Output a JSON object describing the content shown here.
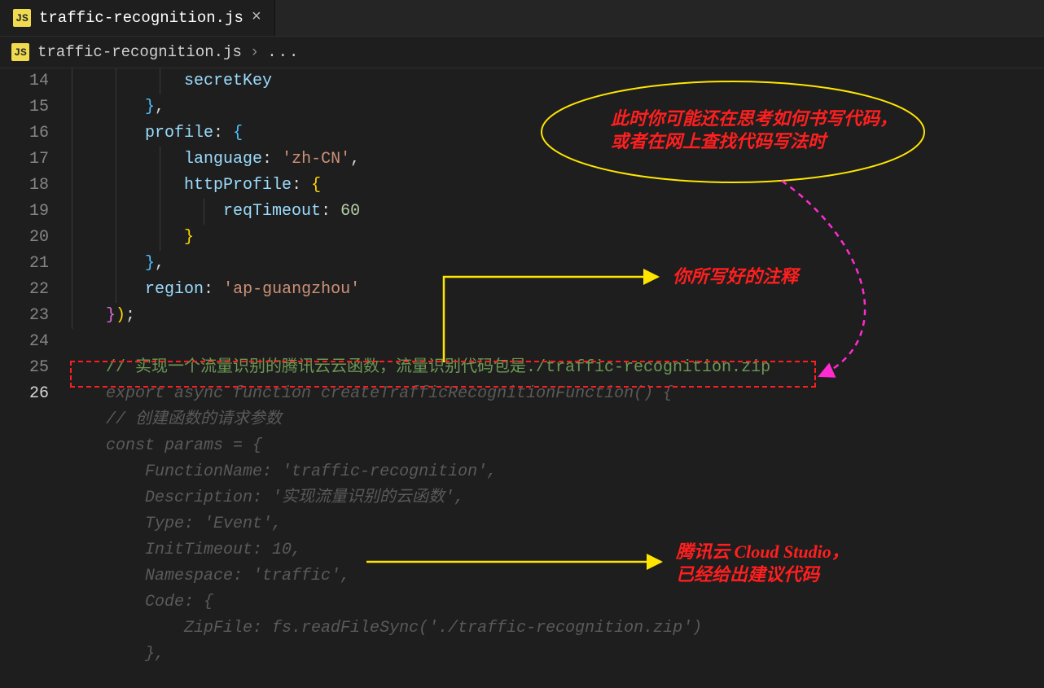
{
  "tab": {
    "filename": "traffic-recognition.js",
    "close": "×"
  },
  "breadcrumb": {
    "icon": "JS",
    "filename": "traffic-recognition.js",
    "sep": "›",
    "dots": "..."
  },
  "lines": {
    "n14": "14",
    "n15": "15",
    "n16": "16",
    "n17": "17",
    "n18": "18",
    "n19": "19",
    "n20": "20",
    "n21": "21",
    "n22": "22",
    "n23": "23",
    "n24": "24",
    "n25": "25",
    "n26": "26"
  },
  "code": {
    "l14_secretKey": "secretKey",
    "l15_brace": "}",
    "l15_comma": ",",
    "l16_profile": "profile",
    "l16_colon": ":",
    "l16_brace": "{",
    "l17_lang": "language",
    "l17_colon": ":",
    "l17_val": "'zh-CN'",
    "l17_comma": ",",
    "l18_http": "httpProfile",
    "l18_colon": ":",
    "l18_brace": "{",
    "l19_req": "reqTimeout",
    "l19_colon": ":",
    "l19_val": "60",
    "l20_brace": "}",
    "l21_brace": "}",
    "l21_comma": ",",
    "l22_region": "region",
    "l22_colon": ":",
    "l22_val": "'ap-guangzhou'",
    "l23_brace1": "}",
    "l23_paren": ")",
    "l23_semi": ";",
    "l25_comment": "// 实现一个流量识别的腾讯云云函数，流量识别代码包是./traffic-recognition.zip",
    "l26_ghost": "export async function createTrafficRecognitionFunction() {"
  },
  "ghost": {
    "g1": "    // 创建函数的请求参数",
    "g2": "    const params = {",
    "g3": "        FunctionName: 'traffic-recognition',",
    "g4": "        Description: '实现流量识别的云函数',",
    "g5": "        Type: 'Event',",
    "g6": "        InitTimeout: 10,",
    "g7": "        Namespace: 'traffic',",
    "g8": "        Code: {",
    "g9": "            ZipFile: fs.readFileSync('./traffic-recognition.zip')",
    "g10": "        },"
  },
  "annotations": {
    "ellipse1": "此时你可能还在思考如何书写代码，",
    "ellipse2": "或者在网上查找代码写法时",
    "arrow1": "你所写好的注释",
    "arrow2a": "腾讯云 Cloud Studio，",
    "arrow2b": "已经给出建议代码"
  }
}
